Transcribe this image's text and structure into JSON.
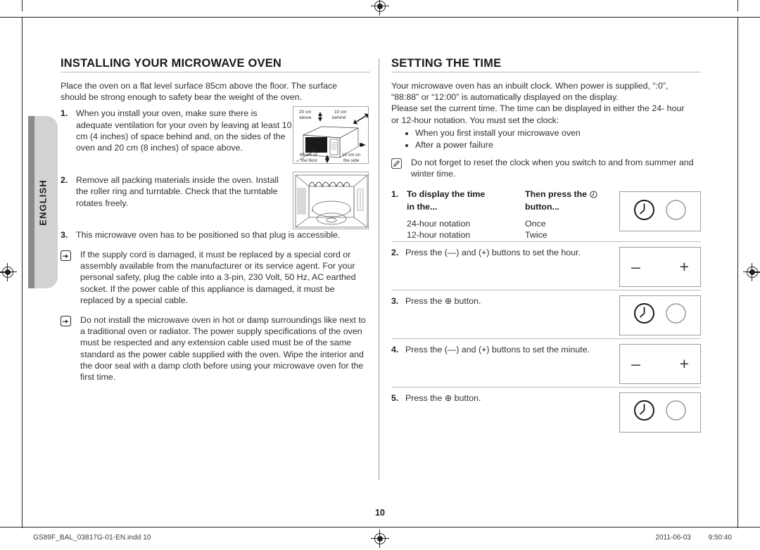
{
  "document": {
    "page_number": "10",
    "side_tab_label": "ENGLISH"
  },
  "left_column": {
    "title": "INSTALLING YOUR MICROWAVE OVEN",
    "intro": "Place the oven on a flat level surface 85cm above the floor. The surface should be strong enough to safety bear the weight of the oven.",
    "steps": [
      {
        "number": "1.",
        "text": "When you install your oven, make sure there is adequate ventilation for your oven by leaving at least 10 cm (4 inches) of space behind and, on the sides of the oven and 20 cm (8 inches) of space above."
      },
      {
        "number": "2.",
        "text": "Remove all packing materials inside the oven. Install the roller ring and turntable. Check that the turntable rotates freely."
      },
      {
        "number": "3.",
        "text": "This microwave oven has to be positioned so that plug is accessible."
      }
    ],
    "notes": [
      "If the supply cord is damaged, it must be replaced by a special cord or assembly available from the manufacturer or its service agent. For your personal safety, plug the cable into a 3-pin, 230 Volt, 50 Hz, AC earthed socket. If the power cable of this appliance is damaged, it must be replaced by a special cable.",
      "Do not install the microwave oven in hot or damp surroundings like next to a traditional oven or radiator. The power supply specifications of the oven must be respected and any extension cable used must be of the same standard as the power cable supplied with the oven. Wipe the interior and the door seal with a damp cloth before using your microwave oven for the first time."
    ],
    "clearance_diagram": {
      "label_above": "20 cm",
      "label_above2": "above",
      "label_behind": "10 cm",
      "label_behind2": "behind",
      "label_floor": "85 cm of",
      "label_floor2": "the floor",
      "label_side": "10 cm on",
      "label_side2": "the side"
    }
  },
  "right_column": {
    "title": "SETTING THE TIME",
    "intro_lines": [
      "Your microwave oven has an inbuilt clock. When power is supplied, “:0”,",
      "“88:88” or “12:00” is automatically displayed on the display.",
      "Please set the current time. The time can be displayed in either the 24- hour",
      "or 12-hour notation. You must set the clock:"
    ],
    "bullets": [
      "When you first install your microwave oven",
      "After a power failure"
    ],
    "note": "Do not forget to reset the clock when you switch to and from summer and winter time.",
    "notation_step": {
      "number": "1.",
      "header_col1": "To display the time in the...",
      "header_col1_line1": "To display the time",
      "header_col1_line2": "in the...",
      "header_col2_line1": "Then press the",
      "header_col2_line2": "button...",
      "rows": [
        {
          "notation": "24-hour notation",
          "presses": "Once"
        },
        {
          "notation": "12-hour notation",
          "presses": "Twice"
        }
      ]
    },
    "steps": [
      {
        "number": "2.",
        "text": "Press the (—) and (+) buttons to set the hour.",
        "panel": "plus-minus"
      },
      {
        "number": "3.",
        "text": "Press the ⊕ button.",
        "panel": "clock"
      },
      {
        "number": "4.",
        "text": "Press the (—) and (+) buttons to set the minute.",
        "panel": "plus-minus"
      },
      {
        "number": "5.",
        "text": "Press the ⊕ button.",
        "panel": "clock"
      }
    ],
    "panel_signs": {
      "minus": "–",
      "plus": "+"
    }
  },
  "footer": {
    "filename": "GS89F_BAL_03817G-01-EN.indd   10",
    "date": "2011-06-03",
    "time": "9:50:40"
  }
}
